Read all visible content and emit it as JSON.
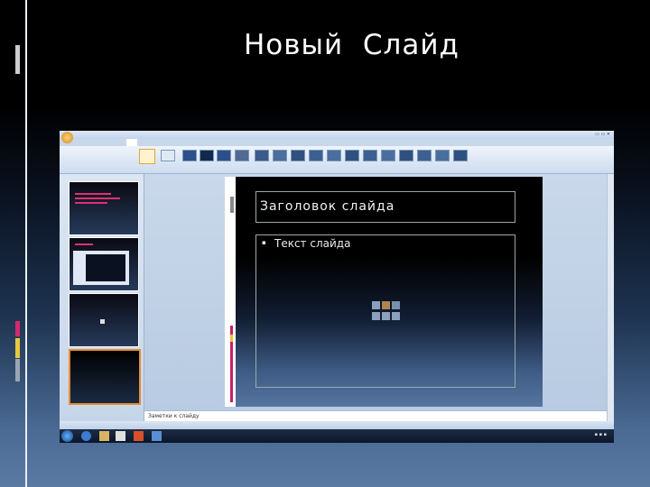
{
  "slide": {
    "title": "Новый  Слайд"
  },
  "screenshot": {
    "colors": {
      "ribbon_highlight": "#e7a536",
      "selected_thumbnail_border": "#e88c30",
      "accent_pink": "#c8206a",
      "accent_yellow": "#e7c53a"
    },
    "editor": {
      "title_placeholder": "Заголовок  слайда",
      "body_placeholder": "Текст слайда",
      "bullet": "▪",
      "notes_placeholder": "Заметки к слайду"
    },
    "icons": [
      "office-button-icon",
      "content-insert-icons",
      "start-button-icon",
      "explorer-icon",
      "media-player-icon",
      "powerpoint-icon"
    ]
  }
}
